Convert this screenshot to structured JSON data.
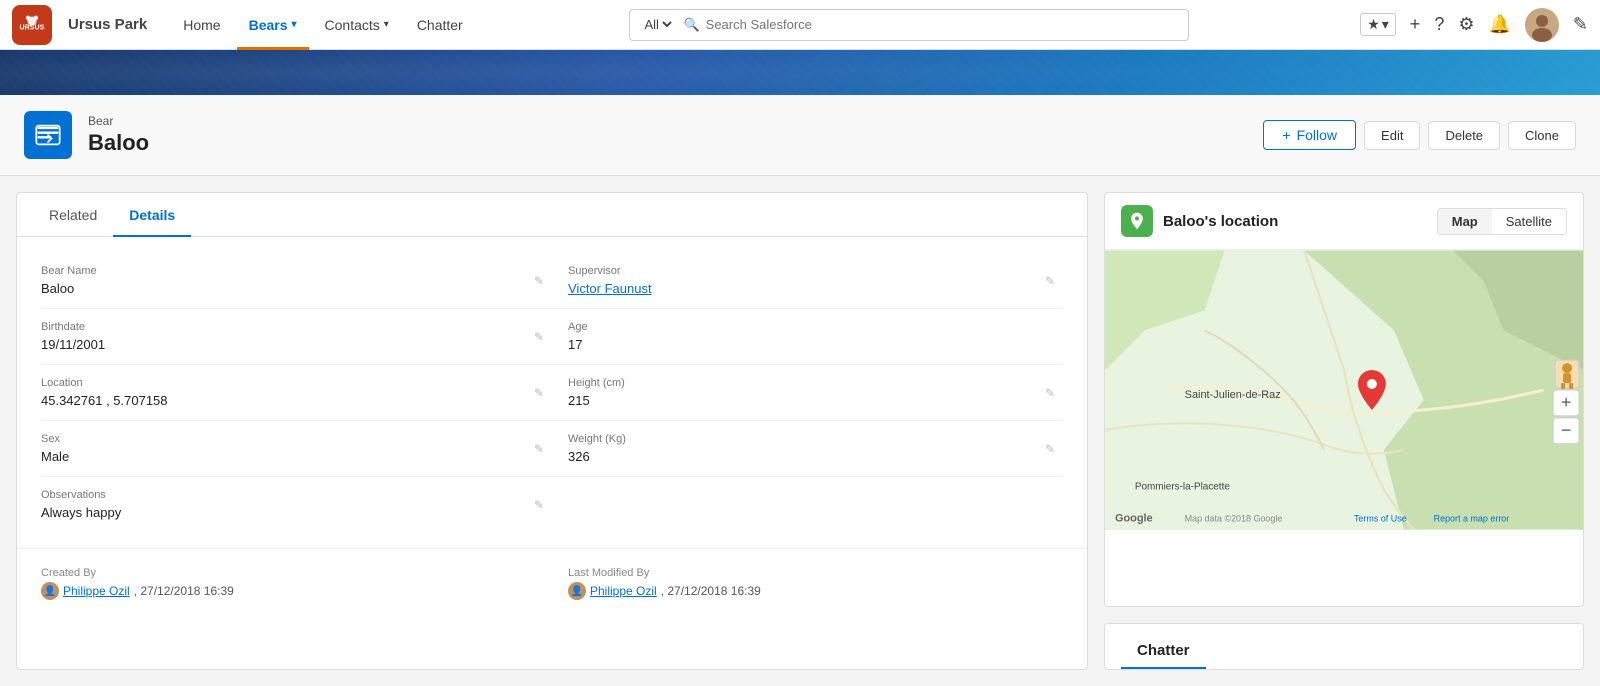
{
  "app": {
    "logo_alt": "Ursus Park",
    "name": "Ursus Park"
  },
  "nav": {
    "home_label": "Home",
    "bears_label": "Bears",
    "contacts_label": "Contacts",
    "chatter_label": "Chatter",
    "edit_icon": "✎"
  },
  "search": {
    "scope_label": "All",
    "placeholder": "Search Salesforce"
  },
  "toolbar_icons": {
    "star": "★",
    "chevron": "▾",
    "plus": "+",
    "help": "?",
    "gear": "⚙",
    "bell": "🔔"
  },
  "record": {
    "object_label": "Bear",
    "name": "Baloo",
    "follow_label": "Follow",
    "edit_label": "Edit",
    "delete_label": "Delete",
    "clone_label": "Clone"
  },
  "tabs": {
    "related_label": "Related",
    "details_label": "Details"
  },
  "fields": {
    "bear_name_label": "Bear Name",
    "bear_name_value": "Baloo",
    "supervisor_label": "Supervisor",
    "supervisor_value": "Victor Faunust",
    "birthdate_label": "Birthdate",
    "birthdate_value": "19/11/2001",
    "age_label": "Age",
    "age_value": "17",
    "location_label": "Location",
    "location_value": "45.342761 , 5.707158",
    "height_label": "Height (cm)",
    "height_value": "215",
    "sex_label": "Sex",
    "sex_value": "Male",
    "weight_label": "Weight (Kg)",
    "weight_value": "326",
    "observations_label": "Observations",
    "observations_value": "Always happy",
    "created_by_label": "Created By",
    "created_by_name": "Philippe Ozil",
    "created_by_date": ", 27/12/2018 16:39",
    "last_modified_label": "Last Modified By",
    "last_modified_name": "Philippe Ozil",
    "last_modified_date": ", 27/12/2018 16:39"
  },
  "map": {
    "title": "Baloo's location",
    "map_tab": "Map",
    "satellite_tab": "Satellite",
    "location_label": "Saint-Julien-de-Raz",
    "bottom_label": "Pommiers-la-Placette",
    "google_label": "Google",
    "map_data_label": "Map data ©2018 Google",
    "terms_label": "Terms of Use",
    "report_label": "Report a map error",
    "zoom_in": "+",
    "zoom_out": "−"
  },
  "chatter": {
    "title": "Chatter"
  }
}
